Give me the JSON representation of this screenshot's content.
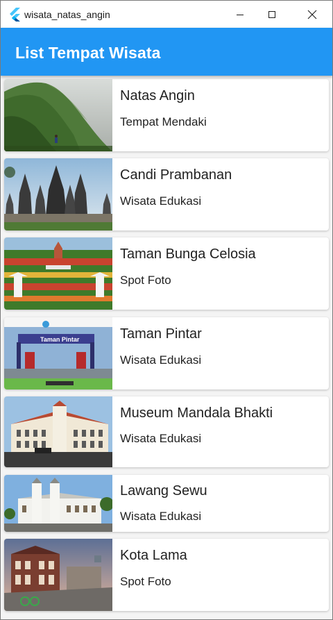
{
  "window": {
    "title": "wisata_natas_angin",
    "minimize_icon": "minimize-icon",
    "maximize_icon": "maximize-icon",
    "close_icon": "close-icon",
    "app_icon": "flutter-logo-icon"
  },
  "appbar": {
    "title": "List Tempat Wisata",
    "color": "#2196f3"
  },
  "places": [
    {
      "name": "Natas Angin",
      "category": "Tempat Mendaki"
    },
    {
      "name": "Candi Prambanan",
      "category": "Wisata Edukasi"
    },
    {
      "name": "Taman Bunga Celosia",
      "category": "Spot Foto"
    },
    {
      "name": "Taman Pintar",
      "category": "Wisata Edukasi"
    },
    {
      "name": "Museum Mandala Bhakti",
      "category": "Wisata Edukasi"
    },
    {
      "name": "Lawang Sewu",
      "category": "Wisata Edukasi"
    },
    {
      "name": "Kota Lama",
      "category": "Spot Foto"
    }
  ],
  "sign_text": "Taman Pintar"
}
